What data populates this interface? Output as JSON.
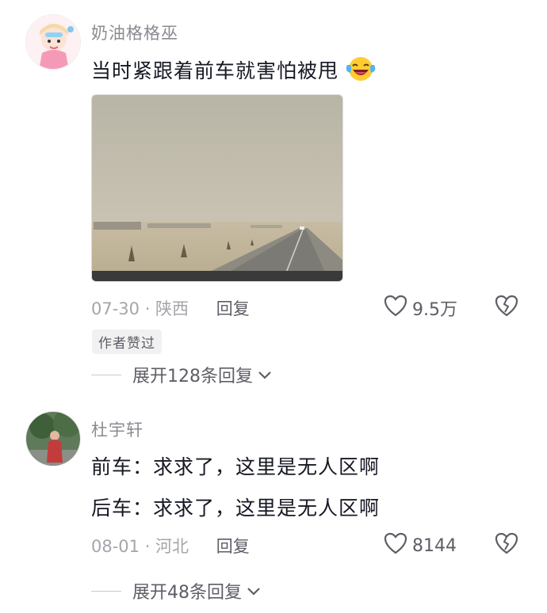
{
  "comments": [
    {
      "username": "奶油格格巫",
      "text": "当时紧跟着前车就害怕被甩",
      "emoji_icon": "laughing-crying-emoji",
      "date": "07-30",
      "location": "陕西",
      "meta": "07-30 · 陕西",
      "reply_label": "回复",
      "likes": "9.5万",
      "badge": "作者赞过",
      "expand_label": "展开128条回复"
    },
    {
      "username": "杜宇轩",
      "lines": [
        "前车：求求了，这里是无人区啊",
        "后车：求求了，这里是无人区啊"
      ],
      "date": "08-01",
      "location": "河北",
      "meta": "08-01 · 河北",
      "reply_label": "回复",
      "likes": "8144",
      "expand_label": "展开48条回复"
    }
  ],
  "colors": {
    "primary_text": "#161823",
    "secondary_text": "#8a8b91",
    "meta_text": "#a4a5ab",
    "action_text": "#5d5e66"
  }
}
